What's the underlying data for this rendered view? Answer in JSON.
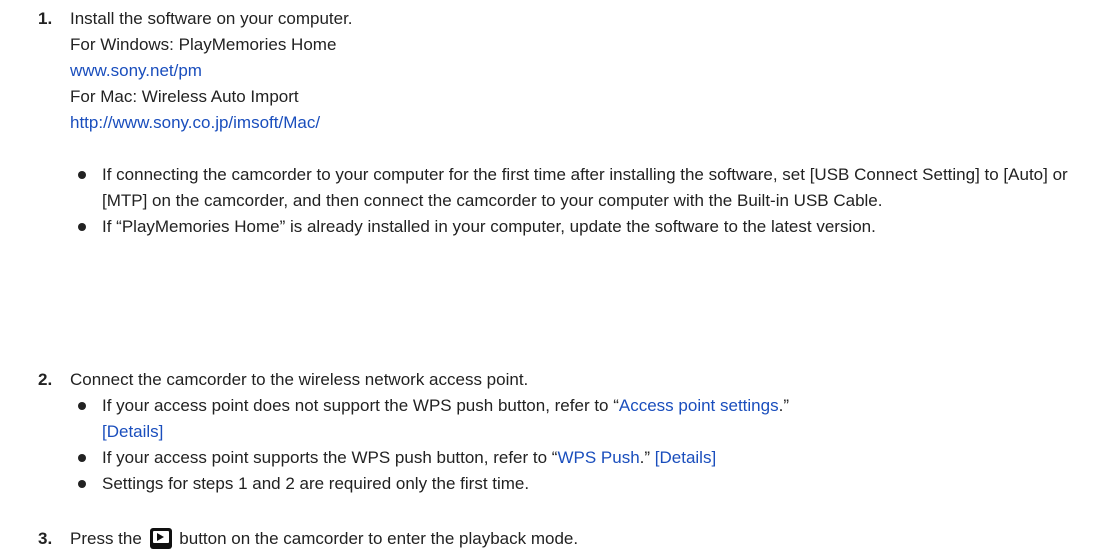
{
  "step1": {
    "number": "1.",
    "title": "Install the software on your computer.",
    "windows_label": "For Windows: PlayMemories Home",
    "windows_link": "www.sony.net/pm",
    "mac_label": "For Mac: Wireless Auto Import",
    "mac_link": "http://www.sony.co.jp/imsoft/Mac/",
    "bullet1": "If connecting the camcorder to your computer for the first time after installing the software, set [USB Connect Setting] to [Auto] or [MTP] on the camcorder, and then connect the camcorder to your computer with the Built-in USB Cable.",
    "bullet2": "If “PlayMemories Home” is already installed in your computer, update the software to the latest version."
  },
  "step2": {
    "number": "2.",
    "title": "Connect the camcorder to the wireless network access point.",
    "bullet1_pre": "If your access point does not support the WPS push button, refer to “",
    "bullet1_link": "Access point settings",
    "bullet1_post": ".”",
    "bullet1_details": "[Details]",
    "bullet2_pre": "If your access point supports the WPS push button, refer to “",
    "bullet2_link": "WPS Push",
    "bullet2_post": ".” ",
    "bullet2_details": "[Details]",
    "bullet3": "Settings for steps 1 and 2 are required only the first time."
  },
  "step3": {
    "number": "3.",
    "text_pre": "Press the",
    "icon": "playback-button-icon",
    "text_post": "button on the camcorder to enter the playback mode."
  },
  "colors": {
    "link": "#1a4ebd",
    "text": "#222222"
  }
}
